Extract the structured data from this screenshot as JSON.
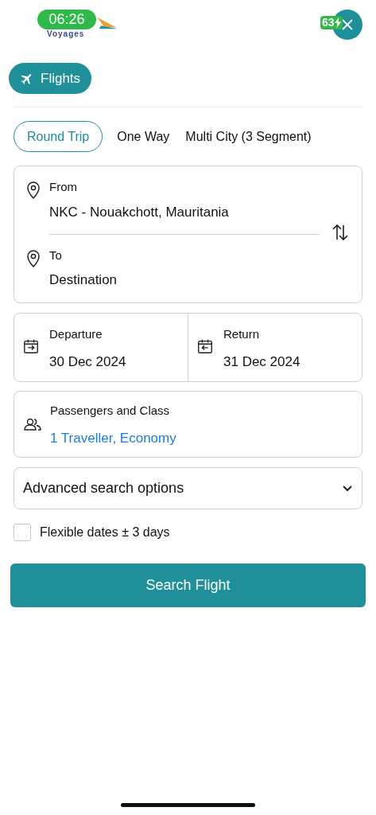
{
  "status_bar": {
    "time": "06:26",
    "battery": "63",
    "charging": true
  },
  "header": {
    "logo_text": "Voyages"
  },
  "product_tab": {
    "label": "Flights",
    "selected": true
  },
  "trip_types": [
    {
      "label": "Round Trip",
      "selected": true
    },
    {
      "label": "One Way",
      "selected": false
    },
    {
      "label": "Multi City (3 Segment)",
      "selected": false
    }
  ],
  "route": {
    "from_label": "From",
    "from_value": "NKC - Nouakchott, Mauritania",
    "to_label": "To",
    "to_placeholder": "Destination"
  },
  "dates": [
    {
      "label": "Departure",
      "value": "30 Dec 2024",
      "kind": "departure"
    },
    {
      "label": "Return",
      "value": "31 Dec 2024",
      "kind": "return"
    }
  ],
  "passengers": {
    "label": "Passengers and Class",
    "value": "1 Traveller, Economy"
  },
  "advanced": {
    "label": "Advanced search options",
    "expanded": false
  },
  "flexible": {
    "label": "Flexible dates ± 3 days",
    "checked": false
  },
  "search_button": "Search Flight"
}
